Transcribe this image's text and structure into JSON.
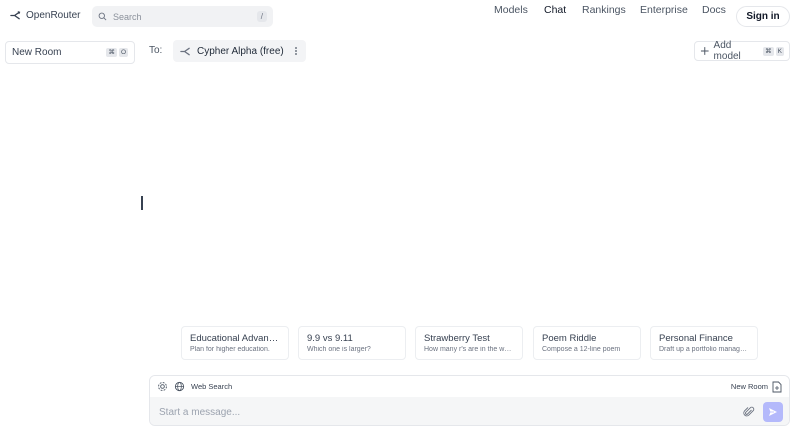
{
  "header": {
    "brand": "OpenRouter",
    "search_placeholder": "Search",
    "search_shortcut": "/",
    "nav": [
      {
        "label": "Models",
        "active": false
      },
      {
        "label": "Chat",
        "active": true
      },
      {
        "label": "Rankings",
        "active": false
      },
      {
        "label": "Enterprise",
        "active": false
      },
      {
        "label": "Docs",
        "active": false
      }
    ],
    "signin_label": "Sign in"
  },
  "sidebar": {
    "room_label": "New Room",
    "room_shortcut": [
      "⌘",
      "O"
    ]
  },
  "main": {
    "to_label": "To:",
    "model_label": "Cypher Alpha (free)",
    "add_model_label": "Add model",
    "add_model_shortcut": [
      "⌘",
      "K"
    ]
  },
  "suggestions": [
    {
      "title": "Educational Advanc...",
      "desc": "Plan for higher education."
    },
    {
      "title": "9.9 vs 9.11",
      "desc": "Which one is larger?"
    },
    {
      "title": "Strawberry Test",
      "desc": "How many r's are in the word"
    },
    {
      "title": "Poem Riddle",
      "desc": "Compose a 12-line poem"
    },
    {
      "title": "Personal Finance",
      "desc": "Draft up a portfolio manage..."
    }
  ],
  "composer": {
    "web_search_label": "Web Search",
    "new_room_label": "New Room",
    "placeholder": "Start a message..."
  },
  "colors": {
    "send_button": "#b4b9fb",
    "accent": "#6366f1"
  },
  "icons": [
    "openrouter-logo-icon",
    "search-icon",
    "settings-icon",
    "globe-icon",
    "new-document-icon",
    "paperclip-icon",
    "send-icon",
    "plus-icon",
    "more-vertical-icon"
  ]
}
